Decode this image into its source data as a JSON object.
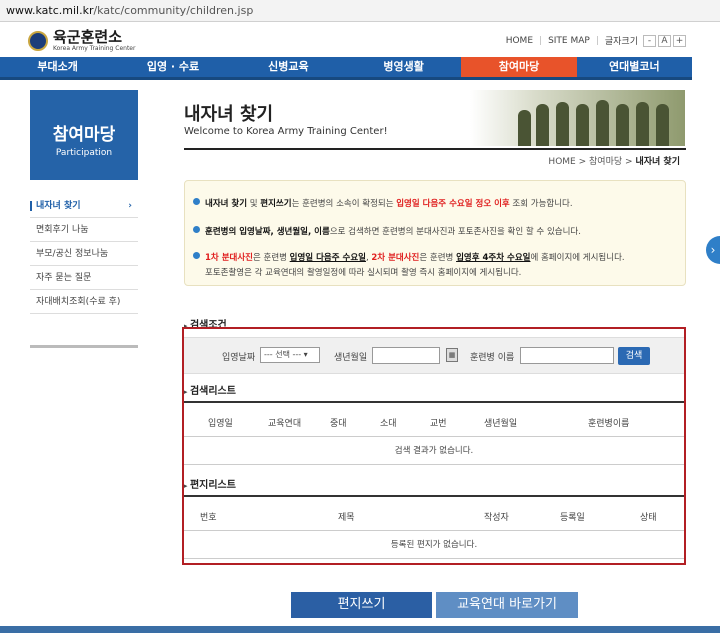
{
  "browser": {
    "url_domain": "www.katc.mil.kr",
    "url_path": "/katc/community/children.jsp"
  },
  "header": {
    "logo_main": "육군훈련소",
    "logo_sub": "Korea Army Training Center",
    "util": {
      "home": "HOME",
      "sitemap": "SITE MAP",
      "font_size": "글자크기",
      "minus": "-",
      "a": "A",
      "plus": "+"
    }
  },
  "nav": [
    "부대소개",
    "입영 · 수료",
    "신병교육",
    "병영생활",
    "참여마당",
    "연대별코너"
  ],
  "side": {
    "title_ko": "참여마당",
    "title_en": "Participation",
    "items": [
      "내자녀 찾기",
      "면회후기 나눔",
      "부모/공신 정보나눔",
      "자주 묻는 질문",
      "자대배치조회(수료 후)"
    ],
    "arrow": "›"
  },
  "page": {
    "title": "내자녀 찾기",
    "subtitle": "Welcome to Korea Army Training Center!",
    "crumb_home": "HOME",
    "crumb_sep": ">",
    "crumb_mid": "참여마당",
    "crumb_cur": "내자녀 찾기"
  },
  "notice": {
    "l1_a": "내자녀 찾기",
    "l1_b": " 및 ",
    "l1_c": "편지쓰기",
    "l1_d": "는 훈련병의 소속이 확정되는 ",
    "l1_e": "입영일 다음주 수요일 정오 이후",
    "l1_f": " 조회 가능합니다.",
    "l2_a": "훈련병의 입영날짜, 생년월일, 이름",
    "l2_b": "으로 검색하면 훈련병의 분대사진과 포토존사진을 확인 할 수 있습니다.",
    "l3_a": "1차 분대사진",
    "l3_b": "은 훈련병 ",
    "l3_c": "입영일 다음주 수요일",
    "l3_d": ", ",
    "l3_e": "2차 분대사진",
    "l3_f": "은 훈련병 ",
    "l3_g": "입영후 4주차 수요일",
    "l3_h": "에 홈페이지에 게시됩니다.",
    "l4": "포토존촬영은 각 교육연대의 촬영일정에 따라 실시되며 촬영 즉시 홈페이지에 게시됩니다."
  },
  "search": {
    "section": "검색조건",
    "date_label": "입영날짜",
    "date_select": "--- 선택 --- ▾",
    "birth_label": "생년월일",
    "cal_icon": "▦",
    "name_label": "훈련병 이름",
    "button": "검색"
  },
  "result_list": {
    "section": "검색리스트",
    "columns": [
      "입영일",
      "교육연대",
      "중대",
      "소대",
      "교번",
      "생년월일",
      "훈련병이름"
    ],
    "empty": "검색 결과가 없습니다."
  },
  "letter_list": {
    "section": "편지리스트",
    "columns": [
      "번호",
      "제목",
      "작성자",
      "등록일",
      "상태"
    ],
    "empty": "등록된 편지가 없습니다."
  },
  "buttons": {
    "write": "편지쓰기",
    "shortcut": "교육연대 바로가기"
  },
  "scroll_arrow": "›",
  "colors": {
    "nav_blue": "#1f5fa8",
    "nav_active": "#e8532a",
    "highlight_red": "#b21f24",
    "notice_bg": "#fdfaea"
  }
}
